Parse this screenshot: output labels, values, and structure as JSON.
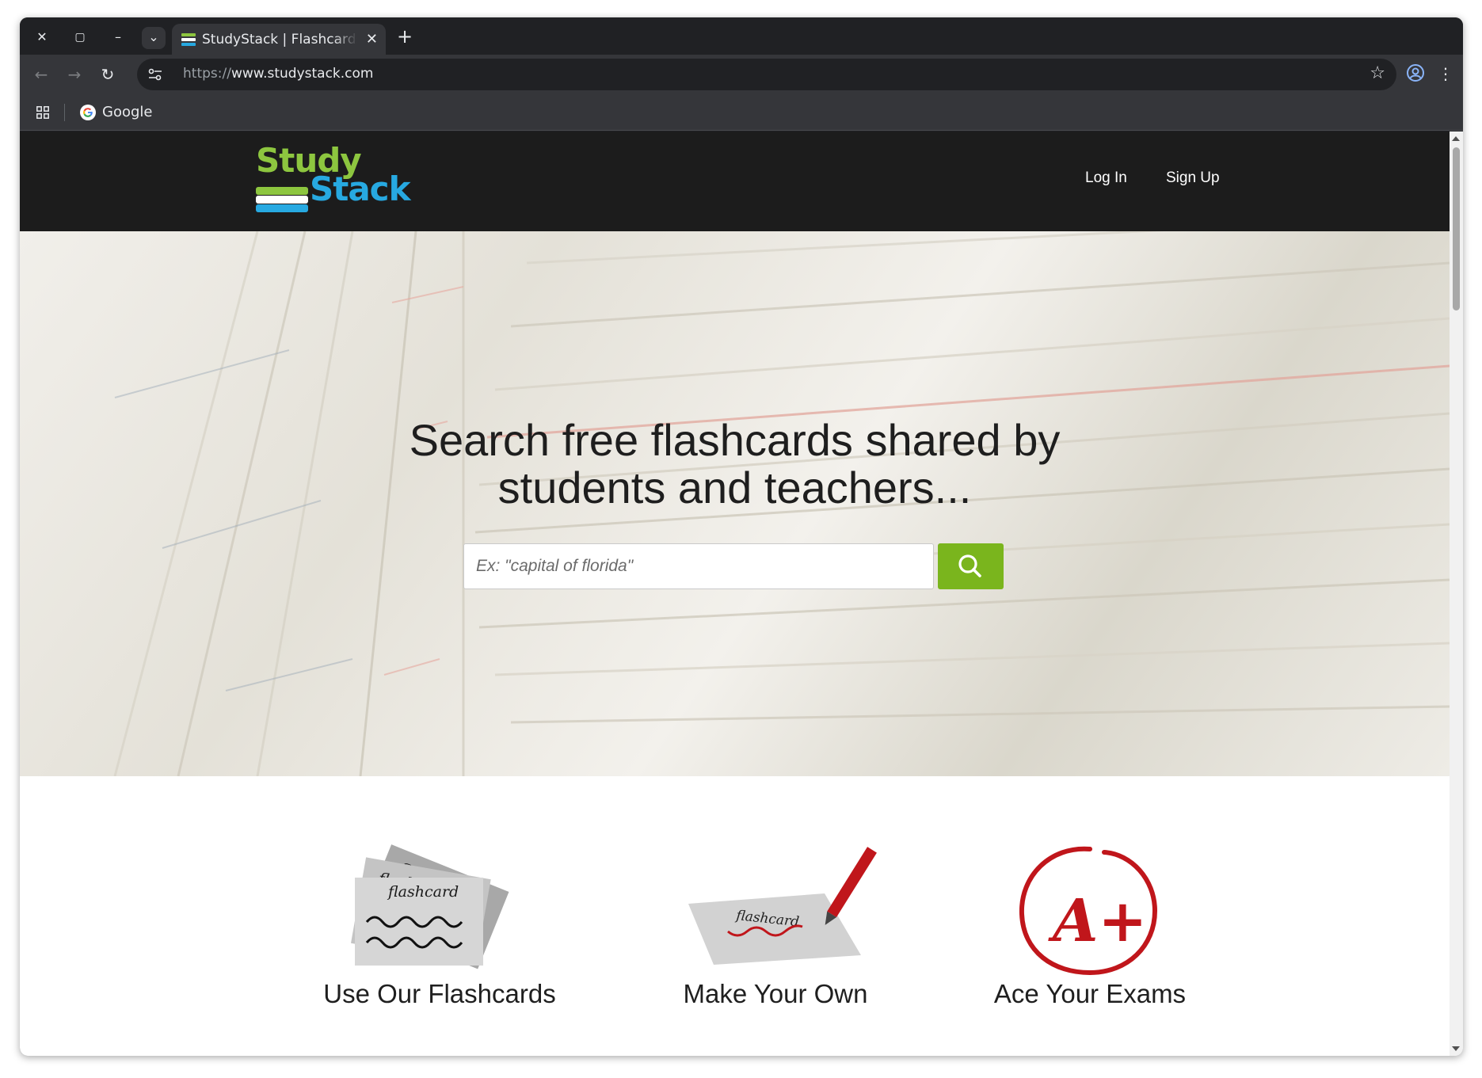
{
  "browser": {
    "tab_title": "StudyStack | Flashcards",
    "tab_close": "✕",
    "new_tab": "+",
    "url_scheme": "https://",
    "url_host": "www.studystack.com",
    "window_controls": {
      "close": "✕",
      "maximize": "▢",
      "minimize": "–",
      "tab_search": "⌄"
    },
    "nav": {
      "back": "←",
      "forward": "→",
      "reload": "↻"
    },
    "star": "☆",
    "menu": "⋮",
    "bookmarks": [
      {
        "label": "Google"
      }
    ]
  },
  "site": {
    "logo_top": "Study",
    "logo_bottom": "Stack",
    "nav_links": [
      "Log In",
      "Sign Up"
    ],
    "hero": {
      "title_line1": "Search free flashcards shared by",
      "title_line2": "students and teachers...",
      "search_placeholder": "Ex: \"capital of florida\""
    },
    "features": [
      {
        "label": "Use Our Flashcards",
        "card_words": [
          "flashc",
          "flashc",
          "flashcard"
        ]
      },
      {
        "label": "Make Your Own",
        "card_word": "flashcard"
      },
      {
        "label": "Ace Your Exams",
        "grade": "A+"
      }
    ]
  },
  "colors": {
    "chrome_dark": "#202124",
    "chrome_toolbar": "#35363a",
    "site_header": "#1c1c1c",
    "logo_green": "#8dc63f",
    "logo_blue": "#27a9e1",
    "search_green": "#7ab51d",
    "grade_red": "#c0161b"
  }
}
